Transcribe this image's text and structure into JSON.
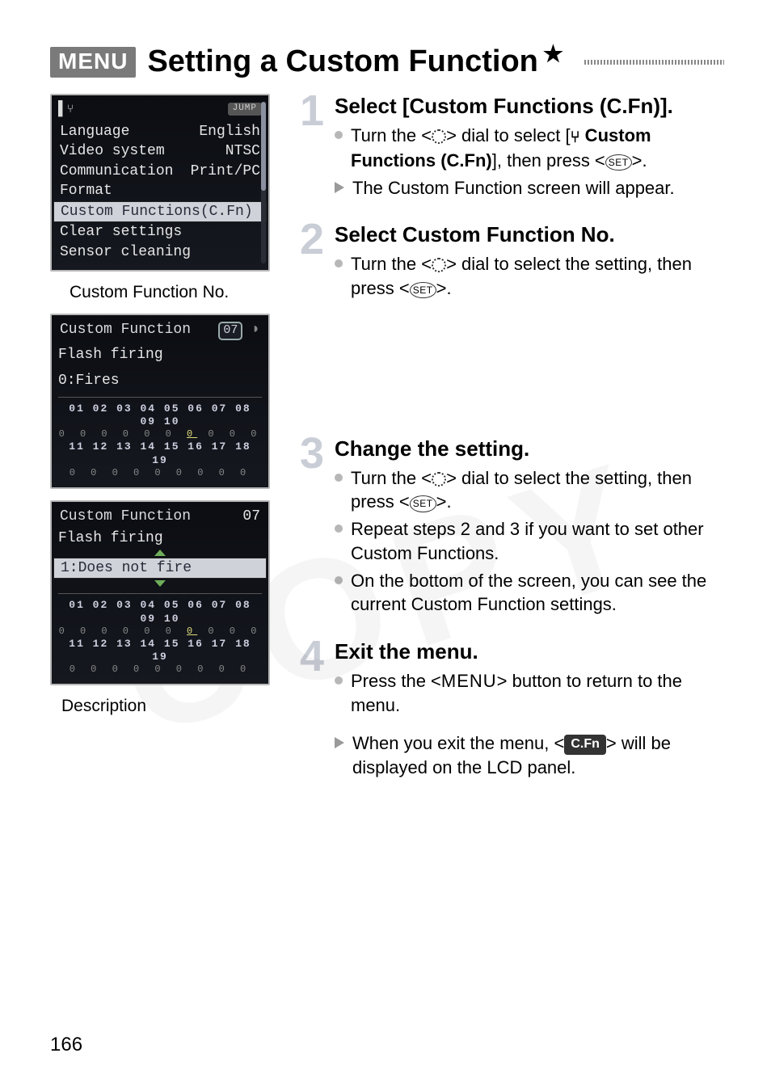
{
  "title": {
    "menu_badge": "MENU",
    "text": "Setting a Custom Function",
    "star": "★"
  },
  "lcd_menu": {
    "jump": "JUMP",
    "rows": [
      {
        "label": "Language",
        "value": "English"
      },
      {
        "label": "Video system",
        "value": "NTSC"
      },
      {
        "label": "Communication",
        "value": "Print/PC"
      },
      {
        "label": "Format",
        "value": ""
      },
      {
        "label": "Custom Functions(C.Fn)",
        "value": "",
        "selected": true
      },
      {
        "label": "Clear settings",
        "value": ""
      },
      {
        "label": "Sensor cleaning",
        "value": ""
      }
    ]
  },
  "caption_cfno": "Custom Function No.",
  "lcd_cf1": {
    "title": "Custom Function",
    "number": "07",
    "name": "Flash firing",
    "value": "0:Fires",
    "matrix_top": "01 02 03 04 05 06 07 08 09 10",
    "matrix_bottom": "11 12 13 14 15 16 17 18 19"
  },
  "lcd_cf2": {
    "title": "Custom Function",
    "number": "07",
    "name": "Flash firing",
    "value": "1:Does not fire",
    "matrix_top": "01 02 03 04 05 06 07 08 09 10",
    "matrix_bottom": "11 12 13 14 15 16 17 18 19"
  },
  "caption_desc": "Description",
  "steps": {
    "s1": {
      "title": "Select [Custom Functions (C.Fn)].",
      "b1a": "Turn the <",
      "b1b": "> dial to select [",
      "b1c": " Custom Functions (C.Fn)",
      "b1d": "], then press <",
      "b1e": ">.",
      "b2": "The Custom Function screen will appear."
    },
    "s2": {
      "title": "Select Custom Function No.",
      "b1a": "Turn the <",
      "b1b": "> dial to select the setting, then press <",
      "b1c": ">."
    },
    "s3": {
      "title": "Change the setting.",
      "b1a": "Turn the <",
      "b1b": "> dial to select the setting, then press <",
      "b1c": ">.",
      "b2": "Repeat steps 2 and 3 if you want to set other Custom Functions.",
      "b3": "On the bottom of the screen, you can see the current Custom Function settings."
    },
    "s4": {
      "title": "Exit the menu.",
      "b1a": "Press the <",
      "b1b": "> button to return to the menu.",
      "menu_word": "MENU",
      "b2a": "When you exit the menu, <",
      "b2b": "> will be displayed on the LCD panel.",
      "cfn_badge": "C.Fn"
    }
  },
  "icons": {
    "set": "SET",
    "tools": "⑂"
  },
  "page_number": "166",
  "watermark": "COPY"
}
